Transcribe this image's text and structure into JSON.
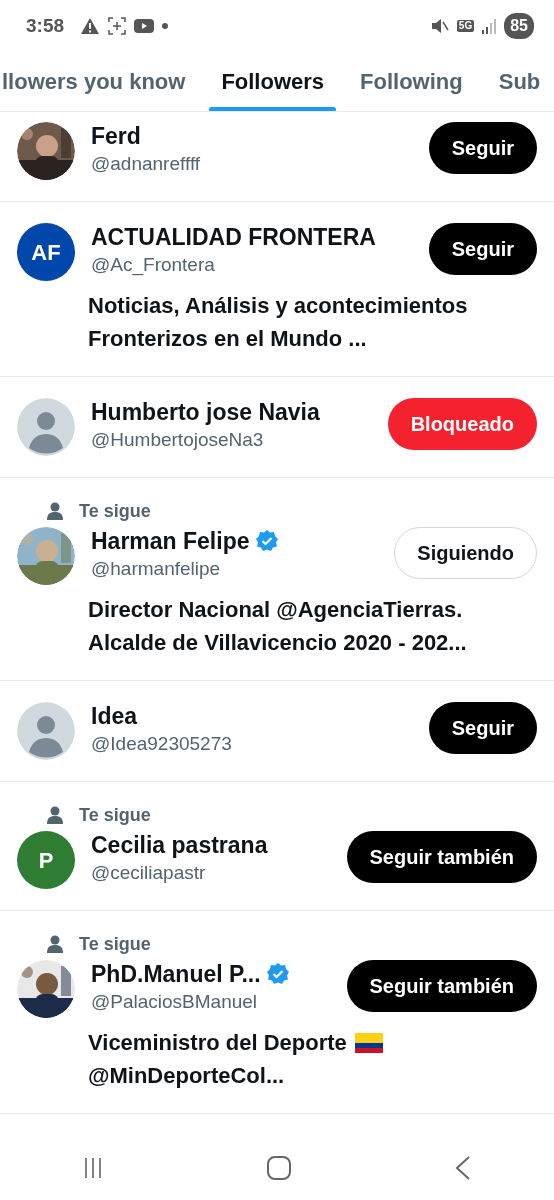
{
  "status_bar": {
    "time": "3:58",
    "network": "5G",
    "battery": "85"
  },
  "tabs": [
    {
      "label": "llowers you know",
      "selected": false
    },
    {
      "label": "Followers",
      "selected": true
    },
    {
      "label": "Following",
      "selected": false
    },
    {
      "label": "Sub",
      "selected": false
    }
  ],
  "users": [
    {
      "name": "Ferd",
      "handle": "@adnanreffff",
      "verified": false,
      "button": {
        "kind": "follow",
        "label": "Seguir"
      }
    },
    {
      "name": "ACTUALIDAD FRONTERA",
      "handle": "@Ac_Frontera",
      "avatar": {
        "kind": "initials",
        "text": "AF",
        "color": "#0047ab"
      },
      "verified": false,
      "bio": [
        "Noticias, Análisis y acontecimientos",
        "Fronterizos en el Mundo ..."
      ],
      "button": {
        "kind": "follow",
        "label": "Seguir"
      }
    },
    {
      "name": "Humberto jose Navia",
      "handle": "@HumbertojoseNa3",
      "avatar": {
        "kind": "default"
      },
      "verified": false,
      "button": {
        "kind": "blocked",
        "label": "Bloqueado"
      }
    },
    {
      "follows_you": "Te sigue",
      "name": "Harman Felipe",
      "handle": "@harmanfelipe",
      "verified": true,
      "bio": [
        "Director Nacional @AgenciaTierras.",
        "Alcalde de Villavicencio 2020 - 202..."
      ],
      "button": {
        "kind": "following",
        "label": "Siguiendo"
      }
    },
    {
      "name": "Idea",
      "handle": "@Idea92305273",
      "avatar": {
        "kind": "default"
      },
      "verified": false,
      "button": {
        "kind": "follow",
        "label": "Seguir"
      }
    },
    {
      "follows_you": "Te sigue",
      "name": "Cecilia pastrana",
      "handle": "@ceciliapastr",
      "avatar": {
        "kind": "initials",
        "text": "P",
        "color": "#2e7d32"
      },
      "verified": false,
      "button": {
        "kind": "follow",
        "label": "Seguir también"
      }
    },
    {
      "follows_you": "Te sigue",
      "name": "PhD.Manuel P...",
      "handle": "@PalaciosBManuel",
      "verified": true,
      "bio": [
        "Viceministro del Deporte",
        "@MinDeporteCol..."
      ],
      "bio_flag": true,
      "button": {
        "kind": "follow",
        "label": "Seguir también"
      }
    }
  ]
}
